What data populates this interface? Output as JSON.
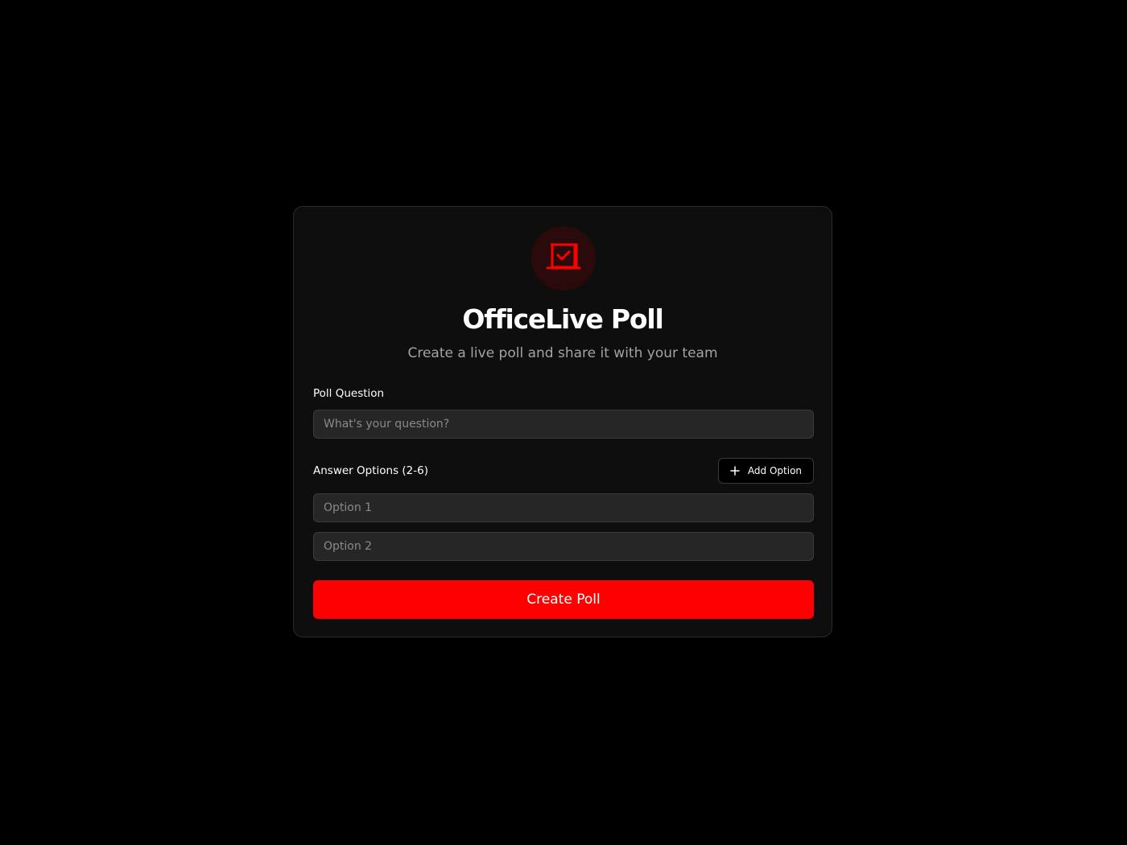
{
  "app": {
    "title": "OfficeLive Poll",
    "subtitle": "Create a live poll and share it with your team",
    "logo_icon": "vote-box-check-icon",
    "accent_color": "#ff0000"
  },
  "form": {
    "question": {
      "label": "Poll Question",
      "placeholder": "What's your question?",
      "value": ""
    },
    "options": {
      "label": "Answer Options (2-6)",
      "add_label": "Add Option",
      "add_icon": "plus-icon",
      "items": [
        {
          "placeholder": "Option 1",
          "value": ""
        },
        {
          "placeholder": "Option 2",
          "value": ""
        }
      ]
    },
    "submit_label": "Create Poll"
  }
}
